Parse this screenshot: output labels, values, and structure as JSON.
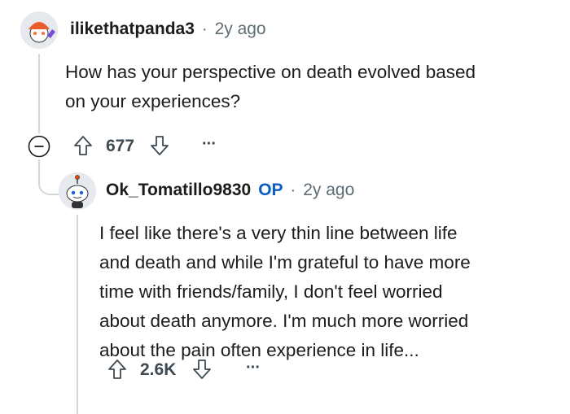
{
  "comments": [
    {
      "username": "ilikethatpanda3",
      "separator": "·",
      "time": "2y ago",
      "body_lines": [
        "How has your perspective on death evolved based",
        "on your experiences?"
      ],
      "votes": "677",
      "more": "···",
      "collapse": "−"
    },
    {
      "username": "Ok_Tomatillo9830",
      "op_badge": "OP",
      "separator": "·",
      "time": "2y ago",
      "body_lines": [
        "I feel like there's a very thin line between life",
        "and death and while I'm grateful to have more",
        "time with friends/family, I don't feel worried",
        "about death anymore. I'm much more worried",
        "about the pain often experience in life..."
      ],
      "votes": "2.6K",
      "more": "···"
    }
  ],
  "icons": {
    "avatar1": "snoo-avatar-panda",
    "avatar2": "snoo-avatar-tomatillo",
    "upvote": "upvote-arrow-icon",
    "downvote": "downvote-arrow-icon",
    "collapse": "collapse-thread-icon",
    "more": "more-options-icon"
  },
  "colors": {
    "op": "#0a5dc2",
    "meta": "#5c6c74",
    "text": "#1c1c1c",
    "thread_line": "#d4d7d9"
  }
}
